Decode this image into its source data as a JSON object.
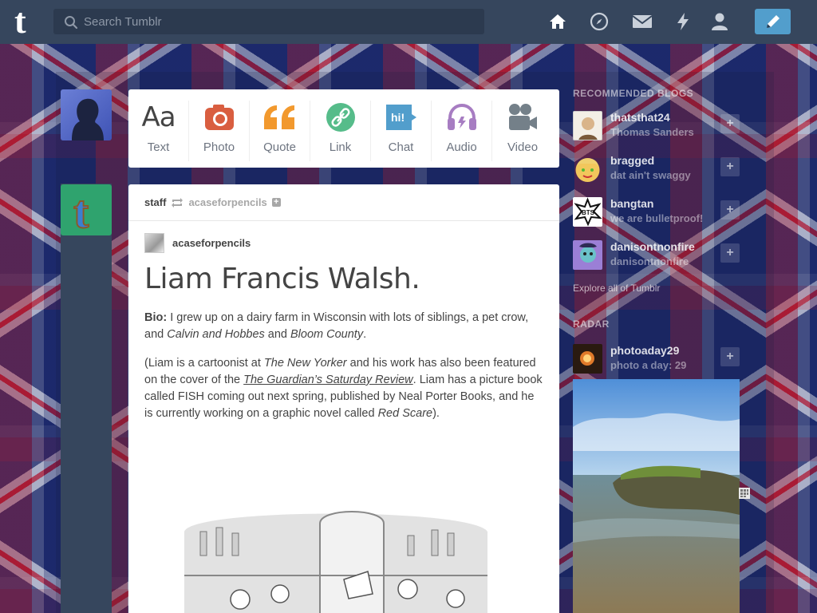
{
  "topbar": {
    "logo_letter": "t",
    "search": {
      "placeholder": "Search Tumblr",
      "value": ""
    },
    "icons": [
      "home-icon",
      "explore-icon",
      "messages-icon",
      "activity-icon",
      "account-icon"
    ],
    "compose_icon": "pencil-icon"
  },
  "post_types": [
    {
      "label": "Text",
      "icon": "text-icon",
      "color": "#444444"
    },
    {
      "label": "Photo",
      "icon": "camera-icon",
      "color": "#d95e40"
    },
    {
      "label": "Quote",
      "icon": "quote-icon",
      "color": "#f2992e"
    },
    {
      "label": "Link",
      "icon": "link-icon",
      "color": "#56bc8a"
    },
    {
      "label": "Chat",
      "icon": "chat-icon",
      "color": "#529ecc"
    },
    {
      "label": "Audio",
      "icon": "headphones-icon",
      "color": "#a77dc2"
    },
    {
      "label": "Video",
      "icon": "video-camera-icon",
      "color": "#748089"
    }
  ],
  "post": {
    "reblogger": "staff",
    "via": "acaseforpencils",
    "source": "acaseforpencils",
    "title": "Liam Francis Walsh.",
    "bio_label": "Bio:",
    "bio_text_1": " I grew up on a dairy farm in Wisconsin with lots of siblings, a pet crow, and ",
    "bio_italic_1": "Calvin and Hobbes",
    "bio_text_2": " and ",
    "bio_italic_2": "Bloom County",
    "bio_text_3": ".",
    "para2_1": "(Liam is a cartoonist at ",
    "para2_it1": "The New Yorker",
    "para2_2": " and his work has also been featured on the cover of the ",
    "para2_link": "The Guardian’s Saturday Review",
    "para2_3": ". Liam has a picture book called FISH coming out next spring, published by Neal Porter Books, and he is currently working on a graphic novel called ",
    "para2_it2": "Red Scare",
    "para2_4": ")."
  },
  "sidebar": {
    "recommended_title": "RECOMMENDED BLOGS",
    "blogs": [
      {
        "name": "thatsthat24",
        "subtitle": "Thomas Sanders"
      },
      {
        "name": "bragged",
        "subtitle": "dat ain't swaggy"
      },
      {
        "name": "bangtan",
        "subtitle": "we are bulletproof!"
      },
      {
        "name": "danisontnonfire",
        "subtitle": "danisontnonfire"
      }
    ],
    "explore_link": "Explore all of Tumblr",
    "radar_title": "RADAR",
    "radar_blog": {
      "name": "photoaday29",
      "subtitle": "photo a day: 29"
    }
  }
}
